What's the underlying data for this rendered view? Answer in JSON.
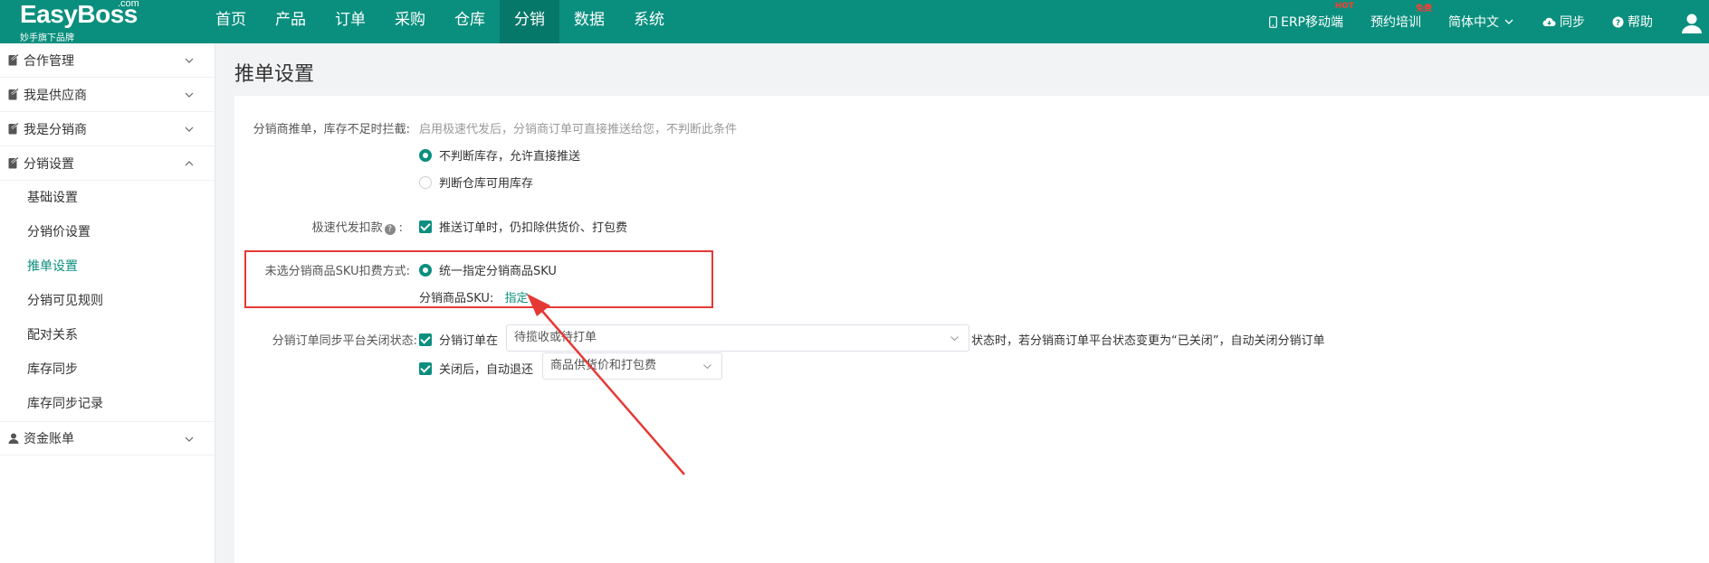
{
  "logo": {
    "brand": "EasyBoss",
    "com": ".com",
    "sub": "妙手旗下品牌"
  },
  "nav": [
    {
      "label": "首页"
    },
    {
      "label": "产品"
    },
    {
      "label": "订单"
    },
    {
      "label": "采购"
    },
    {
      "label": "仓库"
    },
    {
      "label": "分销"
    },
    {
      "label": "数据"
    },
    {
      "label": "系统"
    }
  ],
  "top_right": {
    "erp": "ERP移动端",
    "erp_badge": "HOT",
    "training": "预约培训",
    "training_badge": "免费",
    "lang": "简体中文",
    "sync": "同步",
    "help": "帮助"
  },
  "sidebar": {
    "groups": [
      {
        "label": "合作管理"
      },
      {
        "label": "我是供应商"
      },
      {
        "label": "我是分销商"
      },
      {
        "label": "分销设置"
      },
      {
        "label": "资金账单"
      }
    ],
    "subs": [
      {
        "label": "基础设置"
      },
      {
        "label": "分销价设置"
      },
      {
        "label": "推单设置"
      },
      {
        "label": "分销可见规则"
      },
      {
        "label": "配对关系"
      },
      {
        "label": "库存同步"
      },
      {
        "label": "库存同步记录"
      }
    ]
  },
  "page": {
    "title": "推单设置",
    "push_label": "分销商推单，库存不足时拦截:",
    "push_hint": "启用极速代发后，分销商订单可直接推送给您，不判断此条件",
    "push_opt1": "不判断库存，允许直接推送",
    "push_opt2": "判断仓库可用库存",
    "fast_label": "极速代发扣款",
    "fast_colon": ":",
    "fast_opt": "推送订单时，仍扣除供货价、打包费",
    "sku_label": "未选分销商品SKU扣费方式:",
    "sku_opt": "统一指定分销商品SKU",
    "sku_field": "分销商品SKU:",
    "sku_link": "指定",
    "close_label": "分销订单同步平台关闭状态:",
    "close_opt1": "分销订单在",
    "close_select1": "待揽收或待打单",
    "close_after": "状态时，若分销商订单平台状态变更为“已关闭”，自动关闭分销订单",
    "close_opt2": "关闭后，自动退还",
    "close_select2": "商品供货价和打包费"
  },
  "colors": {
    "brand": "#0a8f7e",
    "highlight": "#e53935"
  }
}
